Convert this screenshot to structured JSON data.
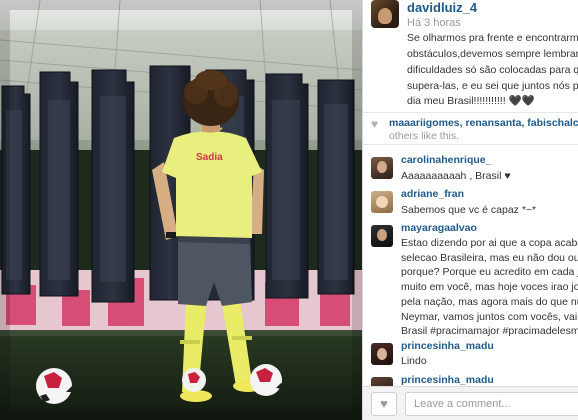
{
  "post": {
    "author": "davidluiz_4",
    "time": "Há 3 horas",
    "caption_lines": [
      "Se olharmos pra frente e encontrarmos",
      "obstáculos,devemos sempre lembrar q",
      "dificuldades só são colocadas para qu",
      "supera-las, e eu sei que juntos nós po",
      "dia meu Brasil!!!!!!!!!!! 🖤🖤"
    ]
  },
  "photo": {
    "shirt_logo": "Sadia"
  },
  "likes": {
    "names": "maaariigomes, renansanta, fabischalch",
    "suffix": "others like this."
  },
  "comments": [
    {
      "user": "carolinahenrique_",
      "lines": [
        "Aaaaaaaaaah , Brasil ♥"
      ]
    },
    {
      "user": "adriane_fran",
      "lines": [
        "Sabemos que vc é capaz *~*"
      ]
    },
    {
      "user": "mayaragaalvao",
      "lines": [
        "Estao dizendo por ai que a copa acaba f",
        "selecao Brasileira, mas eu não dou ouvi",
        "porque? Porque eu acredito em cada jog",
        "muito em você, mas hoje voces irao joga",
        "pela nação, mas agora mais do que nun",
        "Neymar, vamos juntos com vocês, vai qu",
        "Brasil #pracimamajor #pracimadelesmajo"
      ]
    },
    {
      "user": "princesinha_madu",
      "lines": [
        "Lindo"
      ]
    },
    {
      "user": "princesinha_madu",
      "lines": []
    }
  ],
  "comment_box": {
    "placeholder": "Leave a comment..."
  },
  "icons": {
    "heart": "heart-icon",
    "like_button": "heart-icon"
  }
}
